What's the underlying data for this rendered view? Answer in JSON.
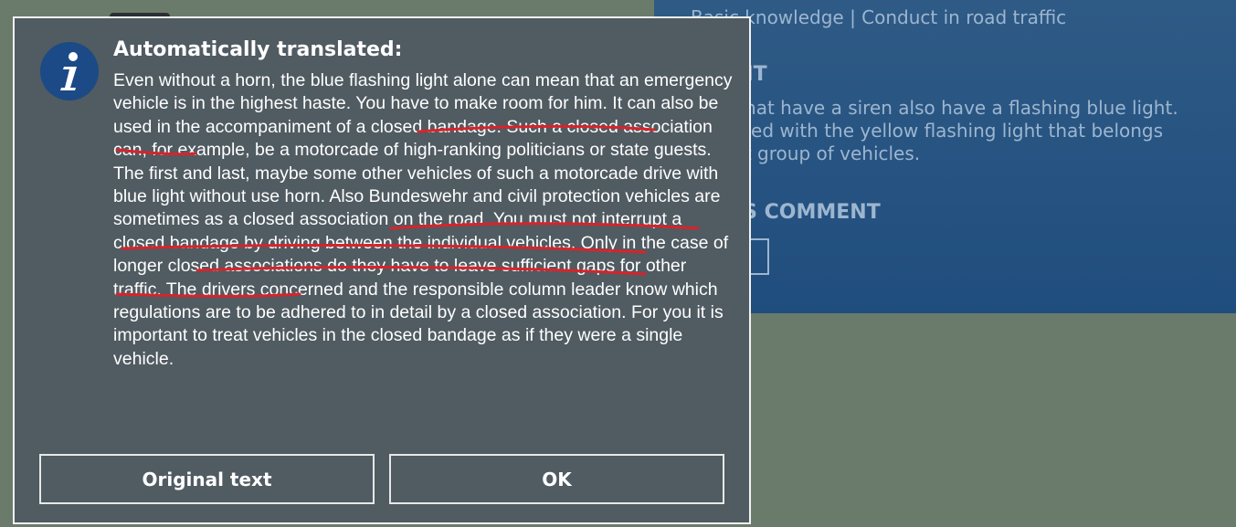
{
  "background": {
    "breadcrumb": "Basic knowledge | Conduct in road traffic",
    "hint_heading": "Y HINT",
    "hint_text": "icles that have a siren also have a flashing blue light. confused with the yellow flashing light that belongs fferent group of vehicles.",
    "comment_heading": "HER'S COMMENT"
  },
  "dialog": {
    "icon": "info-icon",
    "title": "Automatically translated:",
    "body": "Even without a horn, the blue flashing light alone can mean that an emergency vehicle is in the highest haste. You have to make room for him. It can also be used in the accompaniment of a closed bandage. Such a closed association can, for example, be a motorcade of high-ranking politicians or state guests. The first and last, maybe some other vehicles of such a motorcade drive with blue light without use horn. Also Bundeswehr and civil protection vehicles are sometimes as a closed association on the road. You must not interrupt a closed bandage by driving between the individual vehicles. Only in the case of longer closed associations do they have to leave sufficient gaps for other traffic. The drivers concerned and the responsible column leader know which regulations are to be adhered to in detail by a closed association. For you it is important to treat vehicles in the closed bandage as if they were a single vehicle.",
    "buttons": {
      "original_text": "Original text",
      "ok": "OK"
    }
  },
  "colors": {
    "dialog_bg": "#505b62",
    "icon_bg": "#1c4a86",
    "annotation": "#d9232a",
    "page_bg": "#6b7b6b",
    "panel_bg": "#1f4d7d"
  }
}
